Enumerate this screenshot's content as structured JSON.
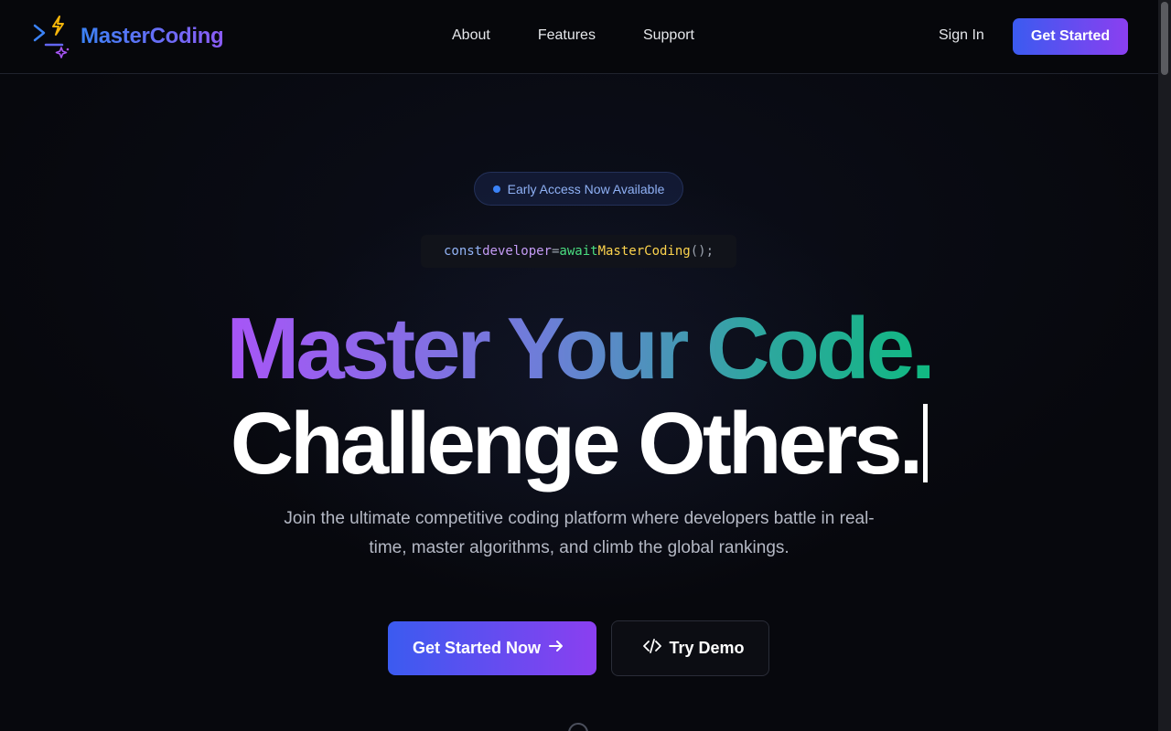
{
  "header": {
    "brand": "MasterCoding",
    "nav": [
      "About",
      "Features",
      "Support"
    ],
    "sign_in": "Sign In",
    "get_started": "Get Started"
  },
  "hero": {
    "badge": "Early Access Now Available",
    "code": {
      "keyword": "const",
      "variable": "developer",
      "operator": "=",
      "await": "await",
      "function": "MasterCoding",
      "tail": "();"
    },
    "headline_line1": "Master Your Code.",
    "headline_line2": "Challenge Others.",
    "subtitle": "Join the ultimate competitive coding platform where developers battle in real-time, master algorithms, and climb the global rankings.",
    "primary_cta": "Get Started Now",
    "secondary_cta": "Try Demo"
  },
  "icons": {
    "logo": "terminal-bolt-icon",
    "primary_cta": "arrow-right-icon",
    "secondary_cta": "code-icon",
    "scroll": "scroll-down-icon"
  },
  "colors": {
    "accent_start": "#3b5bf0",
    "accent_end": "#8b3ff0",
    "background": "#07080d"
  }
}
